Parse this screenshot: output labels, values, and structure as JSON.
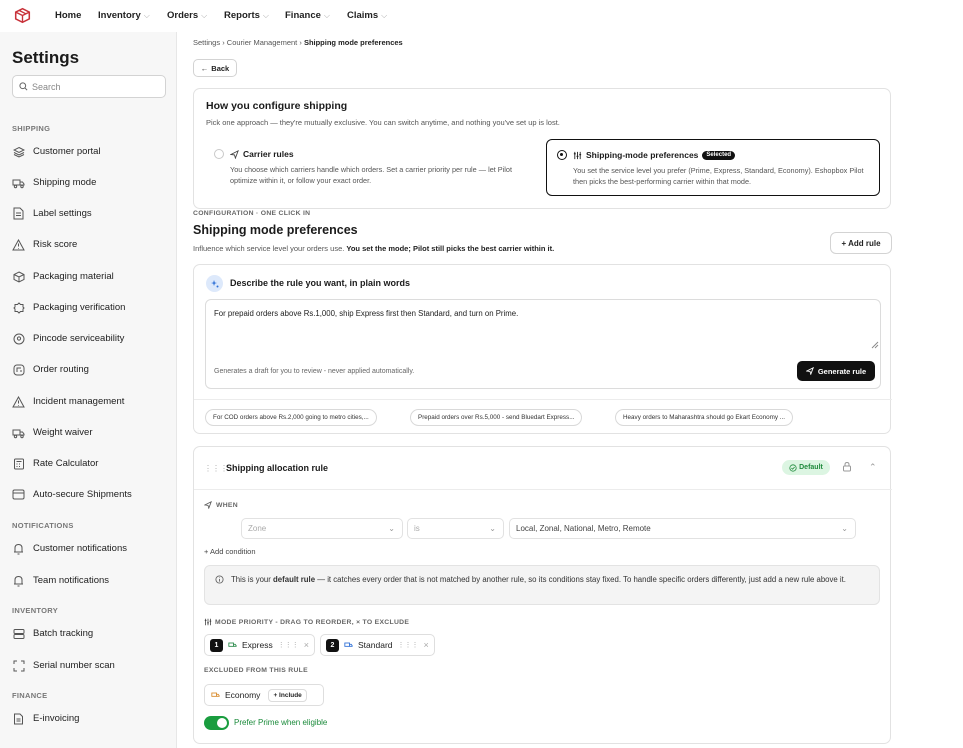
{
  "topnav": {
    "items": [
      {
        "label": "Home",
        "has_dropdown": false
      },
      {
        "label": "Inventory",
        "has_dropdown": true
      },
      {
        "label": "Orders",
        "has_dropdown": true
      },
      {
        "label": "Reports",
        "has_dropdown": true
      },
      {
        "label": "Finance",
        "has_dropdown": true
      },
      {
        "label": "Claims",
        "has_dropdown": true
      }
    ]
  },
  "sidebar": {
    "title": "Settings",
    "search_placeholder": "Search",
    "sections": [
      "SHIPPING",
      "NOTIFICATIONS",
      "INVENTORY",
      "FINANCE"
    ],
    "items": [
      {
        "label": "Customer portal",
        "icon": "layers-icon"
      },
      {
        "label": "Shipping mode",
        "icon": "truck-icon"
      },
      {
        "label": "Label settings",
        "icon": "document-icon"
      },
      {
        "label": "Risk score",
        "icon": "warning-icon"
      },
      {
        "label": "Packaging material",
        "icon": "box-icon"
      },
      {
        "label": "Packaging verification",
        "icon": "verify-badge-icon"
      },
      {
        "label": "Pincode serviceability",
        "icon": "location-pin-icon"
      },
      {
        "label": "Order routing",
        "icon": "route-icon"
      },
      {
        "label": "Incident management",
        "icon": "warning-icon"
      },
      {
        "label": "Weight waiver",
        "icon": "truck-icon"
      },
      {
        "label": "Rate Calculator",
        "icon": "calculator-icon"
      },
      {
        "label": "Auto-secure Shipments",
        "icon": "card-icon"
      },
      {
        "label": "Customer notifications",
        "icon": "bell-icon"
      },
      {
        "label": "Team notifications",
        "icon": "bell-icon"
      },
      {
        "label": "Batch tracking",
        "icon": "batch-icon"
      },
      {
        "label": "Serial number scan",
        "icon": "scan-icon"
      },
      {
        "label": "E-invoicing",
        "icon": "invoice-icon"
      }
    ]
  },
  "breadcrumb": {
    "items": [
      "Settings",
      "Courier Management"
    ],
    "separator": "›",
    "current": "Shipping mode preferences"
  },
  "back_label": "Back",
  "configure": {
    "title": "How you configure shipping",
    "subtitle": "Pick one approach — they're mutually exclusive. You can switch anytime, and nothing you've set up is lost.",
    "options": [
      {
        "title": "Carrier rules",
        "desc": "You choose which carriers handle which orders. Set a carrier priority per rule — let Pilot optimize within it, or follow your exact order.",
        "selected": false
      },
      {
        "title": "Shipping-mode preferences",
        "badge": "Selected",
        "desc": "You set the service level you prefer (Prime, Express, Standard, Economy). Eshopbox Pilot then picks the best-performing carrier within that mode.",
        "selected": true
      }
    ]
  },
  "section": {
    "caption": "CONFIGURATION · ONE CLICK IN",
    "title": "Shipping mode preferences",
    "subtitle_plain": "Influence which service level your orders use. ",
    "subtitle_bold": "You set the mode; Pilot still picks the best carrier within it.",
    "add_rule": "+ Add rule"
  },
  "ai": {
    "title": "Describe the rule you want, in plain words",
    "text": "For prepaid orders above Rs.1,000, ship Express first then Standard, and turn on Prime.",
    "hint": "Generates a draft for you to review - never applied automatically.",
    "generate": "Generate rule",
    "suggestions": [
      "For COD orders above Rs.2,000 going to metro cities,...",
      "Prepaid orders over Rs.5,000 - send Bluedart Express...",
      "Heavy orders to Maharashtra should go Ekart Economy ..."
    ]
  },
  "rule": {
    "title": "Shipping allocation rule",
    "badge": "Default",
    "when_label": "WHEN",
    "field": "Zone",
    "operator": "is",
    "value": "Local, Zonal, National, Metro, Remote",
    "add_condition": "+ Add condition",
    "info_pre": "This is your ",
    "info_bold": "default rule",
    "info_post": " — it catches every order that is not matched by another rule, so its conditions stay fixed. To handle specific orders differently, just add a new rule above it.",
    "priority_caption": "MODE PRIORITY - DRAG TO REORDER, × TO EXCLUDE",
    "modes": [
      {
        "num": "1",
        "label": "Express"
      },
      {
        "num": "2",
        "label": "Standard"
      }
    ],
    "excluded_caption": "EXCLUDED FROM THIS RULE",
    "excluded": [
      {
        "label": "Economy",
        "action": "Include"
      }
    ],
    "prime_label": "Prefer Prime when eligible",
    "prime_on": true
  },
  "colors": {
    "accent_green": "#1a9d3f",
    "dark": "#111111",
    "brand_red": "#c8323a"
  }
}
